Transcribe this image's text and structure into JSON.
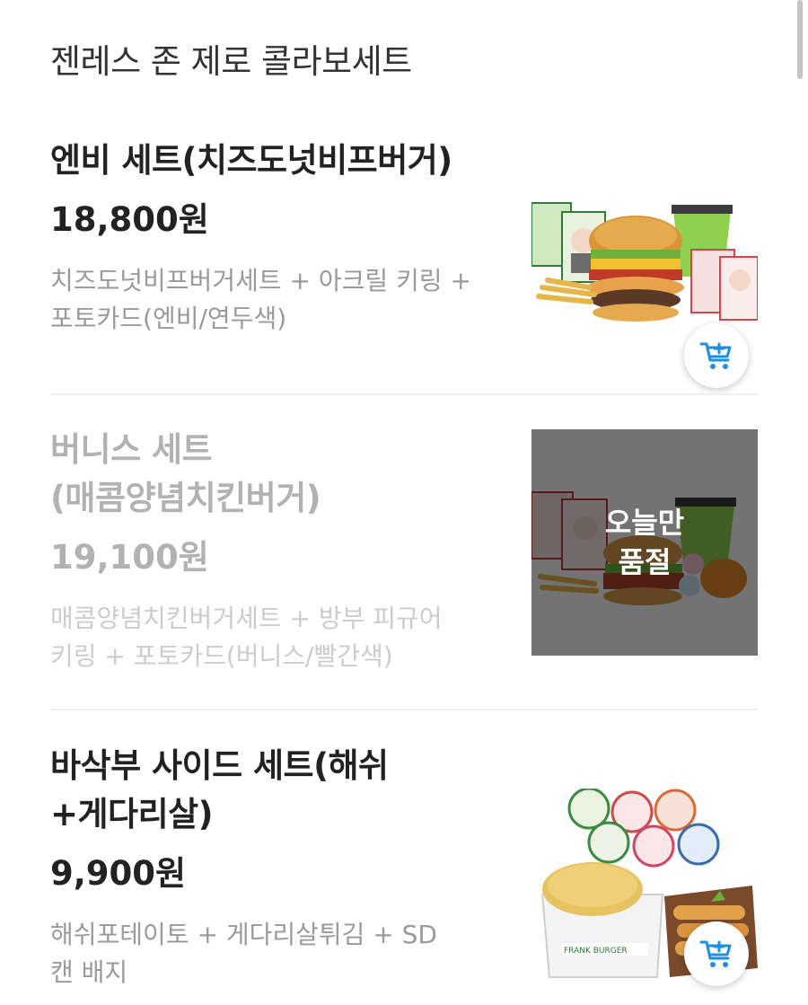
{
  "section": {
    "title": "젠레스 존 제로 콜라보세트"
  },
  "items": [
    {
      "name": "엔비 세트(치즈도넛비프버거)",
      "price": "18,800원",
      "desc_line1": "치즈도넛비프버거세트 + 아크릴 키링 +",
      "desc_line2": "포토카드(엔비/연두색)",
      "image_icon": "burger-set-photo",
      "sold_out": false
    },
    {
      "name_line1": "버니스 세트",
      "name_line2": "(매콤양념치킨버거)",
      "price": "19,100원",
      "desc_line1": "매콤양념치킨버거세트 + 방부 피규어",
      "desc_line2": "키링 + 포토카드(버니스/빨간색)",
      "image_icon": "chicken-burger-set-photo",
      "sold_out": true,
      "overlay_line1": "오늘만",
      "overlay_line2": "품절"
    },
    {
      "name_line1": "바삭부 사이드 세트(해쉬",
      "name_line2": "+게다리살)",
      "price": "9,900원",
      "desc_line1": "해쉬포테이토 + 게다리살튀김 + SD",
      "desc_line2": "캔 배지",
      "image_icon": "side-set-photo",
      "brand_text": "FRANK BURGER",
      "sold_out": false
    }
  ],
  "colors": {
    "accent": "#1e8fdc",
    "soldout_overlay": "#000000"
  }
}
